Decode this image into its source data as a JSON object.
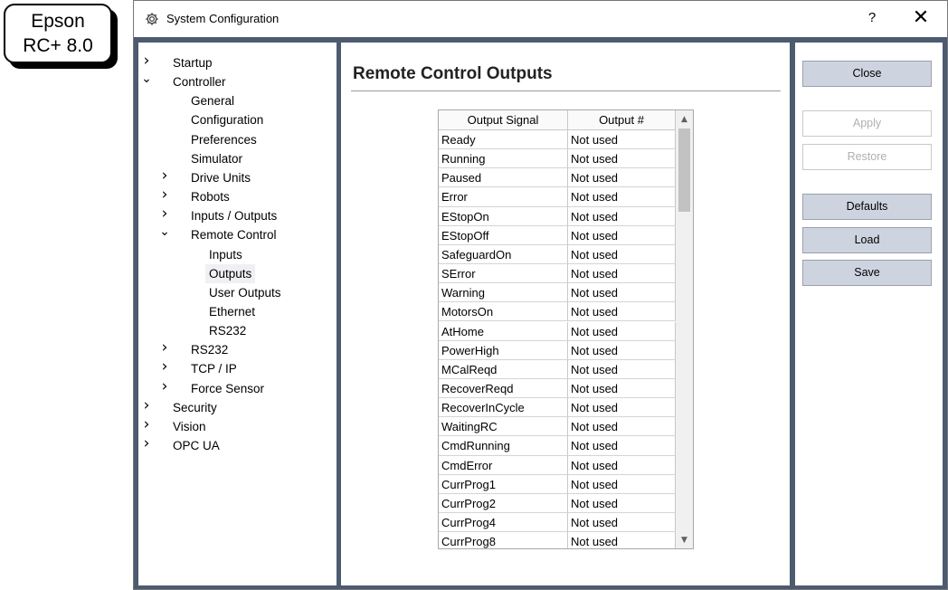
{
  "badge": {
    "line1": "Epson",
    "line2": "RC+ 8.0"
  },
  "window": {
    "title": "System Configuration",
    "icon": "gear-icon",
    "help_label": "?",
    "close_label": "✕"
  },
  "tree": [
    {
      "label": "Startup",
      "level": 0,
      "chevron": "right"
    },
    {
      "label": "Controller",
      "level": 0,
      "chevron": "down"
    },
    {
      "label": "General",
      "level": 1,
      "chevron": "none"
    },
    {
      "label": "Configuration",
      "level": 1,
      "chevron": "none"
    },
    {
      "label": "Preferences",
      "level": 1,
      "chevron": "none"
    },
    {
      "label": "Simulator",
      "level": 1,
      "chevron": "none"
    },
    {
      "label": "Drive Units",
      "level": 1,
      "chevron": "right"
    },
    {
      "label": "Robots",
      "level": 1,
      "chevron": "right"
    },
    {
      "label": "Inputs / Outputs",
      "level": 1,
      "chevron": "right"
    },
    {
      "label": "Remote Control",
      "level": 1,
      "chevron": "down"
    },
    {
      "label": "Inputs",
      "level": 2,
      "chevron": "none"
    },
    {
      "label": "Outputs",
      "level": 2,
      "chevron": "none",
      "selected": true
    },
    {
      "label": "User Outputs",
      "level": 2,
      "chevron": "none"
    },
    {
      "label": "Ethernet",
      "level": 2,
      "chevron": "none"
    },
    {
      "label": "RS232",
      "level": 2,
      "chevron": "none"
    },
    {
      "label": "RS232",
      "level": 1,
      "chevron": "right"
    },
    {
      "label": "TCP / IP",
      "level": 1,
      "chevron": "right"
    },
    {
      "label": "Force Sensor",
      "level": 1,
      "chevron": "right"
    },
    {
      "label": "Security",
      "level": 0,
      "chevron": "right"
    },
    {
      "label": "Vision",
      "level": 0,
      "chevron": "right"
    },
    {
      "label": "OPC UA",
      "level": 0,
      "chevron": "right"
    }
  ],
  "main": {
    "title": "Remote Control Outputs",
    "table": {
      "columns": [
        "Output Signal",
        "Output #"
      ],
      "rows": [
        [
          "Ready",
          "Not used"
        ],
        [
          "Running",
          "Not used"
        ],
        [
          "Paused",
          "Not used"
        ],
        [
          "Error",
          "Not used"
        ],
        [
          "EStopOn",
          "Not used"
        ],
        [
          "EStopOff",
          "Not used"
        ],
        [
          "SafeguardOn",
          "Not used"
        ],
        [
          "SError",
          "Not used"
        ],
        [
          "Warning",
          "Not used"
        ],
        [
          "MotorsOn",
          "Not used"
        ],
        [
          "AtHome",
          "Not used"
        ],
        [
          "PowerHigh",
          "Not used"
        ],
        [
          "MCalReqd",
          "Not used"
        ],
        [
          "RecoverReqd",
          "Not used"
        ],
        [
          "RecoverInCycle",
          "Not used"
        ],
        [
          "WaitingRC",
          "Not used"
        ],
        [
          "CmdRunning",
          "Not used"
        ],
        [
          "CmdError",
          "Not used"
        ],
        [
          "CurrProg1",
          "Not used"
        ],
        [
          "CurrProg2",
          "Not used"
        ],
        [
          "CurrProg4",
          "Not used"
        ],
        [
          "CurrProg8",
          "Not used"
        ]
      ]
    }
  },
  "buttons": [
    {
      "label": "Close",
      "enabled": true
    },
    {
      "label": "Apply",
      "enabled": false
    },
    {
      "label": "Restore",
      "enabled": false
    },
    {
      "label": "Defaults",
      "enabled": true
    },
    {
      "label": "Load",
      "enabled": true
    },
    {
      "label": "Save",
      "enabled": true
    }
  ]
}
